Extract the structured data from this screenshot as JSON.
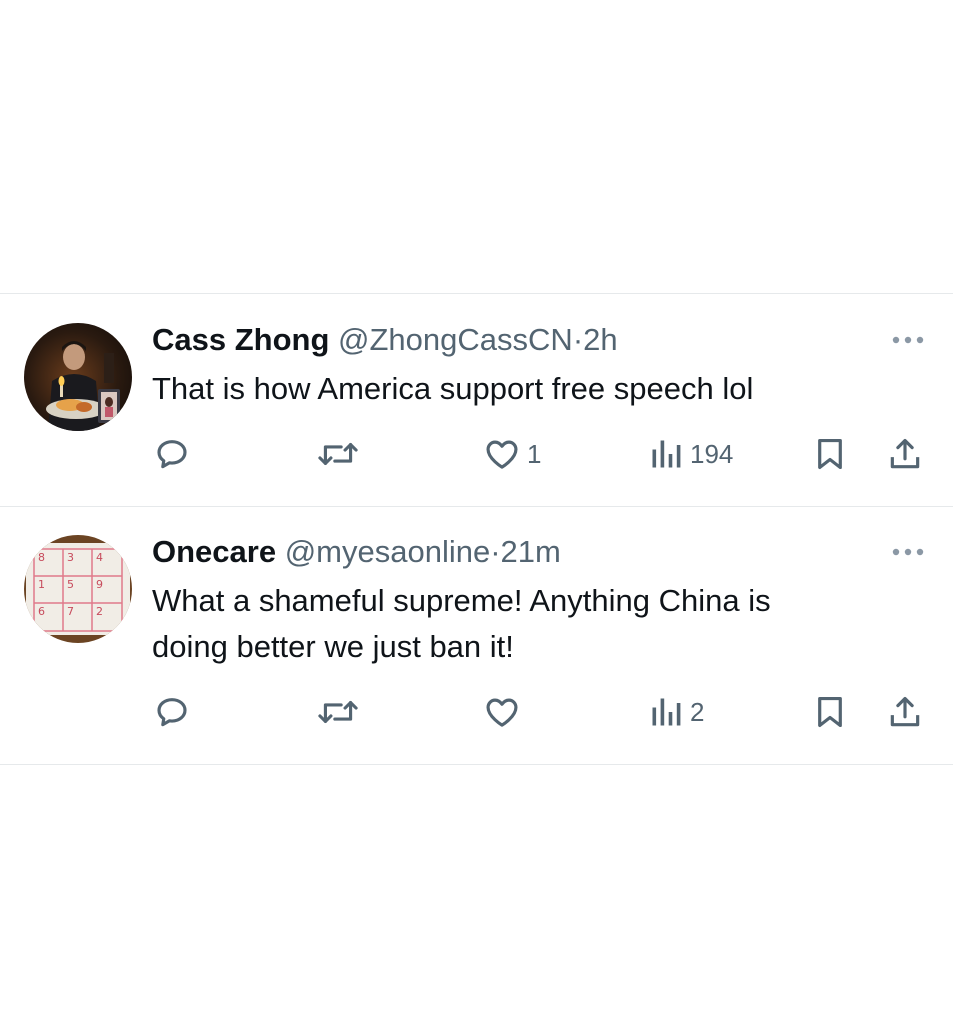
{
  "tweets": [
    {
      "name": "Cass Zhong",
      "handle": "@ZhongCassCN",
      "separator": "·",
      "time": "2h",
      "text": "That is how America support free speech lol",
      "replies": "",
      "reposts": "",
      "likes": "1",
      "views": "194"
    },
    {
      "name": "Onecare",
      "handle": "@myesaonline",
      "separator": "·",
      "time": "21m",
      "text_lines": [
        "What a shameful supreme! Anything China is",
        "doing better we just ban it!"
      ],
      "replies": "",
      "reposts": "",
      "likes": "",
      "views": "2"
    }
  ],
  "avatar2_grid": [
    "8",
    "3",
    "4",
    "1",
    "5",
    "9",
    "6",
    "7",
    "2"
  ],
  "icons": [
    "more-icon",
    "reply-icon",
    "repost-icon",
    "like-icon",
    "views-icon",
    "bookmark-icon",
    "share-icon"
  ],
  "colors": {
    "text": "#0f1419",
    "secondary": "#536471",
    "divider": "#e6e9eb"
  }
}
